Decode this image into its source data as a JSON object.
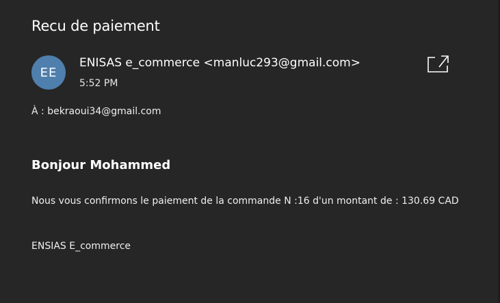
{
  "email": {
    "subject": "Recu de paiement",
    "avatar_initials": "EE",
    "avatar_color": "#4f7fac",
    "sender": "ENISAS e_commerce <manluc293@gmail.com>",
    "time": "5:52 PM",
    "to_line": "À : bekraoui34@gmail.com",
    "popout_icon": "open-in-new-window-icon",
    "greeting": "Bonjour Mohammed",
    "message": "Nous vous confirmons le paiement de la commande N :16 d'un montant de : 130.69 CAD",
    "signature": "ENSIAS E_commerce"
  },
  "colors": {
    "background": "#262626",
    "text": "#ffffff"
  }
}
